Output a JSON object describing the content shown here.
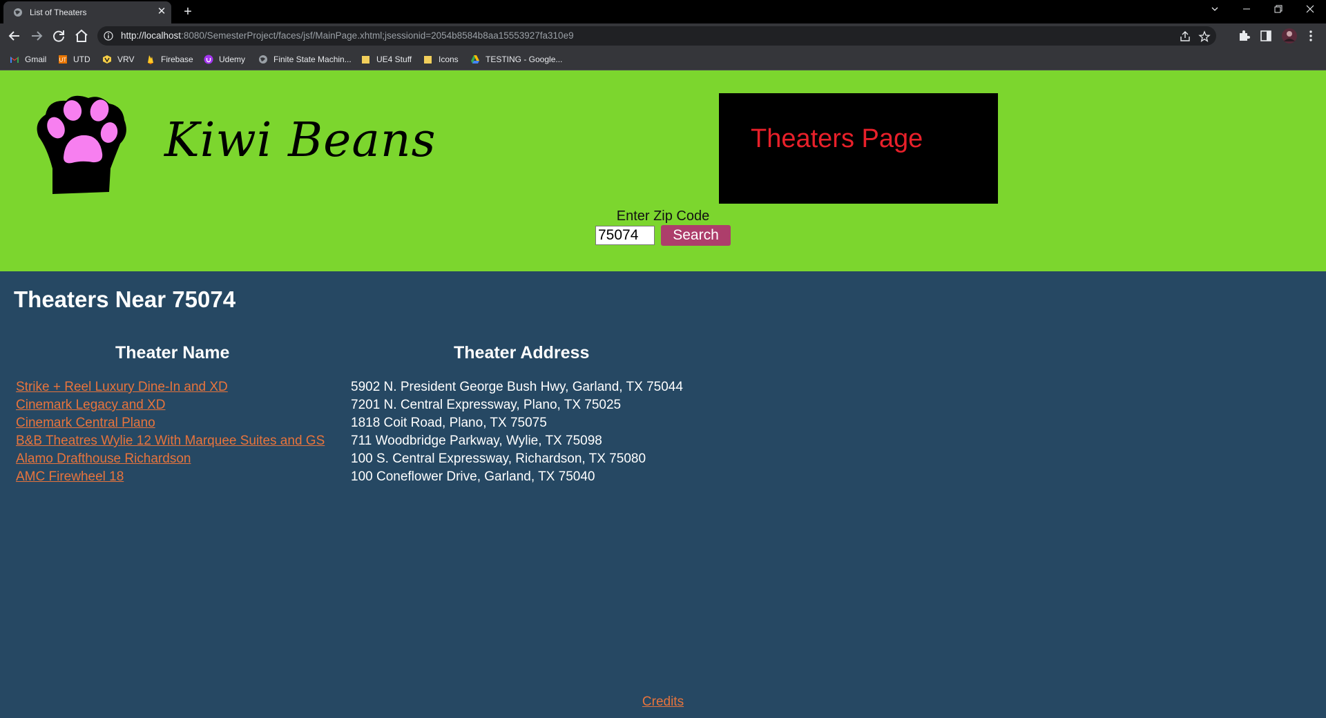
{
  "browser": {
    "tab_title": "List of Theaters",
    "url_host": "http://localhost",
    "url_rest": ":8080/SemesterProject/faces/jsf/MainPage.xhtml;jsessionid=2054b8584b8aa15553927fa310e9",
    "bookmarks": [
      {
        "label": "Gmail",
        "icon": "gmail-icon"
      },
      {
        "label": "UTD",
        "icon": "utd-icon"
      },
      {
        "label": "VRV",
        "icon": "vrv-icon"
      },
      {
        "label": "Firebase",
        "icon": "firebase-icon"
      },
      {
        "label": "Udemy",
        "icon": "udemy-icon"
      },
      {
        "label": "Finite State Machin...",
        "icon": "globe-icon"
      },
      {
        "label": "UE4 Stuff",
        "icon": "folder-icon"
      },
      {
        "label": "Icons",
        "icon": "folder-icon"
      },
      {
        "label": "TESTING - Google...",
        "icon": "google-drive-icon"
      }
    ]
  },
  "header": {
    "brand": "Kiwi Beans",
    "banner_text": "Theaters Page",
    "zip_label": "Enter Zip Code",
    "zip_value": "75074",
    "search_label": "Search"
  },
  "main": {
    "heading": "Theaters Near 75074",
    "col_name": "Theater Name",
    "col_address": "Theater Address",
    "theaters": [
      {
        "name": "Strike + Reel Luxury Dine-In and XD",
        "address": "5902 N. President George Bush Hwy, Garland, TX 75044"
      },
      {
        "name": "Cinemark Legacy and XD",
        "address": "7201 N. Central Expressway, Plano, TX 75025"
      },
      {
        "name": "Cinemark Central Plano",
        "address": "1818 Coit Road, Plano, TX 75075"
      },
      {
        "name": "B&B Theatres Wylie 12 With Marquee Suites and GS",
        "address": "711 Woodbridge Parkway, Wylie, TX 75098"
      },
      {
        "name": "Alamo Drafthouse Richardson",
        "address": "100 S. Central Expressway, Richardson, TX 75080"
      },
      {
        "name": "AMC Firewheel 18",
        "address": "100 Coneflower Drive, Garland, TX 75040"
      }
    ],
    "credits": "Credits"
  },
  "colors": {
    "header_bg": "#7cd62e",
    "body_bg": "#264863",
    "link": "#e8743c",
    "button": "#ad3e6b",
    "banner_text": "#e8202a",
    "paw_pad": "#f77ff0"
  }
}
